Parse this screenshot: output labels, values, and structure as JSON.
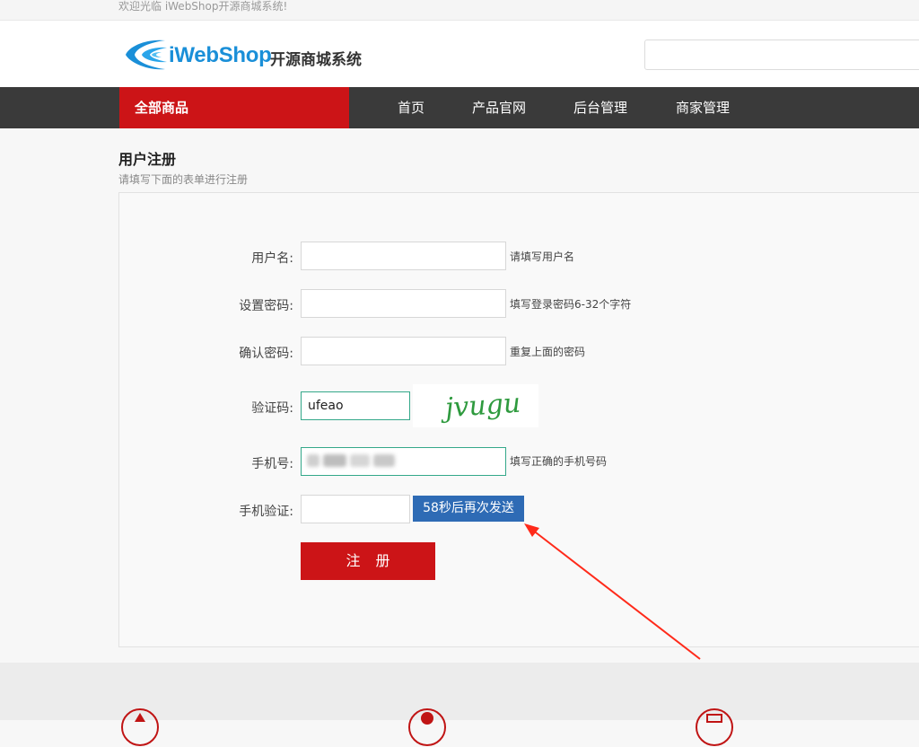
{
  "topbar": {
    "welcome": "欢迎光临 iWebShop开源商城系统!"
  },
  "header": {
    "logo_en": "iWebShop",
    "logo_cn": "开源商城系统",
    "search_placeholder": ""
  },
  "nav": {
    "all_products": "全部商品",
    "items": [
      "首页",
      "产品官网",
      "后台管理",
      "商家管理"
    ]
  },
  "page": {
    "title": "用户注册",
    "subtitle": "请填写下面的表单进行注册"
  },
  "form": {
    "username": {
      "label": "用户名:",
      "value": "",
      "hint": "请填写用户名"
    },
    "password": {
      "label": "设置密码:",
      "value": "",
      "hint": "填写登录密码6-32个字符"
    },
    "confirm": {
      "label": "确认密码:",
      "value": "",
      "hint": "重复上面的密码"
    },
    "captcha": {
      "label": "验证码:",
      "value": "ufeao",
      "image_text": "jvugu"
    },
    "phone": {
      "label": "手机号:",
      "value": "",
      "hint": "填写正确的手机号码"
    },
    "sms": {
      "label": "手机验证:",
      "value": "",
      "button": "58秒后再次发送"
    },
    "submit": "注 册"
  },
  "colors": {
    "brand_red": "#cc1417",
    "nav_dark": "#3a3a3a",
    "sms_blue": "#2e6bb5",
    "focus_green": "#34a88a",
    "annotation_red": "#ff2a1a"
  }
}
